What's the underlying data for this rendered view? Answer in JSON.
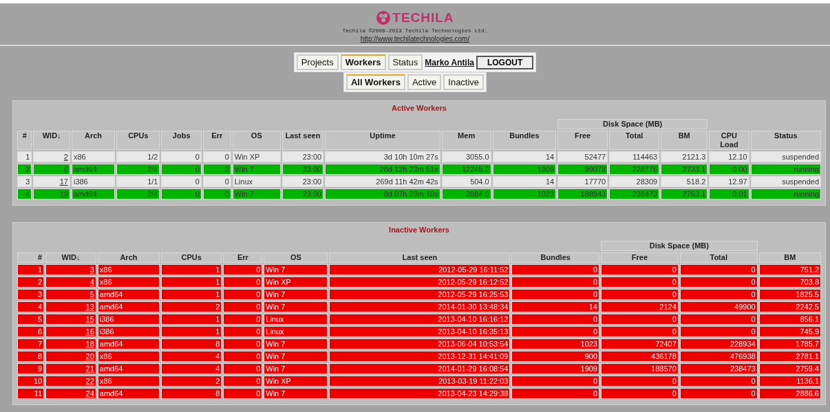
{
  "header": {
    "logo_text": "TECHILA",
    "copyright": "Techila ©2006-2013 Techila Technologies Ltd.",
    "url": "http://www.techilatechnologies.com/"
  },
  "nav": {
    "tabs": [
      {
        "label": "Projects",
        "selected": false
      },
      {
        "label": "Workers",
        "selected": true
      },
      {
        "label": "Status",
        "selected": false
      }
    ],
    "user": "Marko Antila",
    "logout": "LOGOUT",
    "subtabs": [
      {
        "label": "All Workers",
        "selected": true
      },
      {
        "label": "Active",
        "selected": false
      },
      {
        "label": "Inactive",
        "selected": false
      }
    ]
  },
  "active_workers": {
    "title": "Active Workers",
    "group_header": "Disk Space (MB)",
    "columns": [
      "#",
      "WID↓",
      "Arch",
      "CPUs",
      "Jobs",
      "Err",
      "OS",
      "Last seen",
      "Uptime",
      "Mem",
      "Bundles",
      "Free",
      "Total",
      "BM",
      "CPU Load",
      "Status"
    ],
    "rows": [
      {
        "highlighted": false,
        "cells": [
          "1",
          "2",
          "x86",
          "1/2",
          "0",
          "0",
          "Win XP",
          "23:00",
          "3d 10h 10m 27s",
          "3055.0",
          "14",
          "52477",
          "114463",
          "2121.3",
          "12.10",
          "suspended"
        ]
      },
      {
        "highlighted": true,
        "cells": [
          "2",
          "6",
          "amd64",
          "2/4",
          "0",
          "0",
          "Win 7",
          "23:00",
          "28d 12h 23m 51s",
          "12245.0",
          "1909",
          "99078",
          "228776",
          "2733.1",
          "0.00",
          "running"
        ]
      },
      {
        "highlighted": false,
        "cells": [
          "3",
          "17",
          "i386",
          "1/1",
          "0",
          "0",
          "Linux",
          "23:00",
          "269d 11h 42m 42s",
          "504.0",
          "14",
          "17770",
          "28309",
          "518.2",
          "12.97",
          "suspended"
        ]
      },
      {
        "highlighted": true,
        "cells": [
          "4",
          "19",
          "amd64",
          "2/4",
          "0",
          "0",
          "Win 7",
          "23:00",
          "8d 07h 23m 10s",
          "3984.0",
          "1023",
          "188943",
          "238473",
          "2763.1",
          "0.01",
          "running"
        ]
      }
    ]
  },
  "inactive_workers": {
    "title": "Inactive Workers",
    "group_header": "Disk Space (MB)",
    "columns": [
      "#",
      "WID↓",
      "Arch",
      "CPUs",
      "Err",
      "OS",
      "Last seen",
      "Bundles",
      "Free",
      "Total",
      "BM"
    ],
    "rows": [
      [
        "1",
        "3",
        "x86",
        "1",
        "0",
        "Win 7",
        "2012-05-29 16:11:52",
        "0",
        "0",
        "0",
        "751.2"
      ],
      [
        "2",
        "4",
        "x86",
        "1",
        "0",
        "Win XP",
        "2012-05-29 16:12:52",
        "0",
        "0",
        "0",
        "703.8"
      ],
      [
        "3",
        "5",
        "amd64",
        "1",
        "0",
        "Win 7",
        "2012-05-29 16:25:53",
        "0",
        "0",
        "0",
        "1825.5"
      ],
      [
        "4",
        "13",
        "amd64",
        "2",
        "0",
        "Win 7",
        "2014-01-30 13:48:34",
        "14",
        "2124",
        "49900",
        "2242.5"
      ],
      [
        "5",
        "15",
        "i386",
        "1",
        "0",
        "Linux",
        "2013-04-10 16:16:12",
        "0",
        "0",
        "0",
        "856.1"
      ],
      [
        "6",
        "16",
        "i386",
        "1",
        "0",
        "Linux",
        "2013-04-10 16:35:13",
        "0",
        "0",
        "0",
        "745.9"
      ],
      [
        "7",
        "18",
        "amd64",
        "8",
        "0",
        "Win 7",
        "2013-06-04 10:53:54",
        "1023",
        "72407",
        "228934",
        "1785.7"
      ],
      [
        "8",
        "20",
        "x86",
        "4",
        "0",
        "Win 7",
        "2013-12-31 14:41:09",
        "900",
        "436178",
        "476938",
        "2781.1"
      ],
      [
        "9",
        "21",
        "amd64",
        "4",
        "0",
        "Win 7",
        "2014-01-29 16:08:54",
        "1909",
        "188570",
        "238473",
        "2759.4"
      ],
      [
        "10",
        "22",
        "x86",
        "2",
        "0",
        "Win XP",
        "2013-03-19 11:22:03",
        "0",
        "0",
        "0",
        "1136.1"
      ],
      [
        "11",
        "24",
        "amd64",
        "8",
        "0",
        "Win 7",
        "2013-04-23 14:29:38",
        "0",
        "0",
        "0",
        "2886.6"
      ]
    ]
  }
}
